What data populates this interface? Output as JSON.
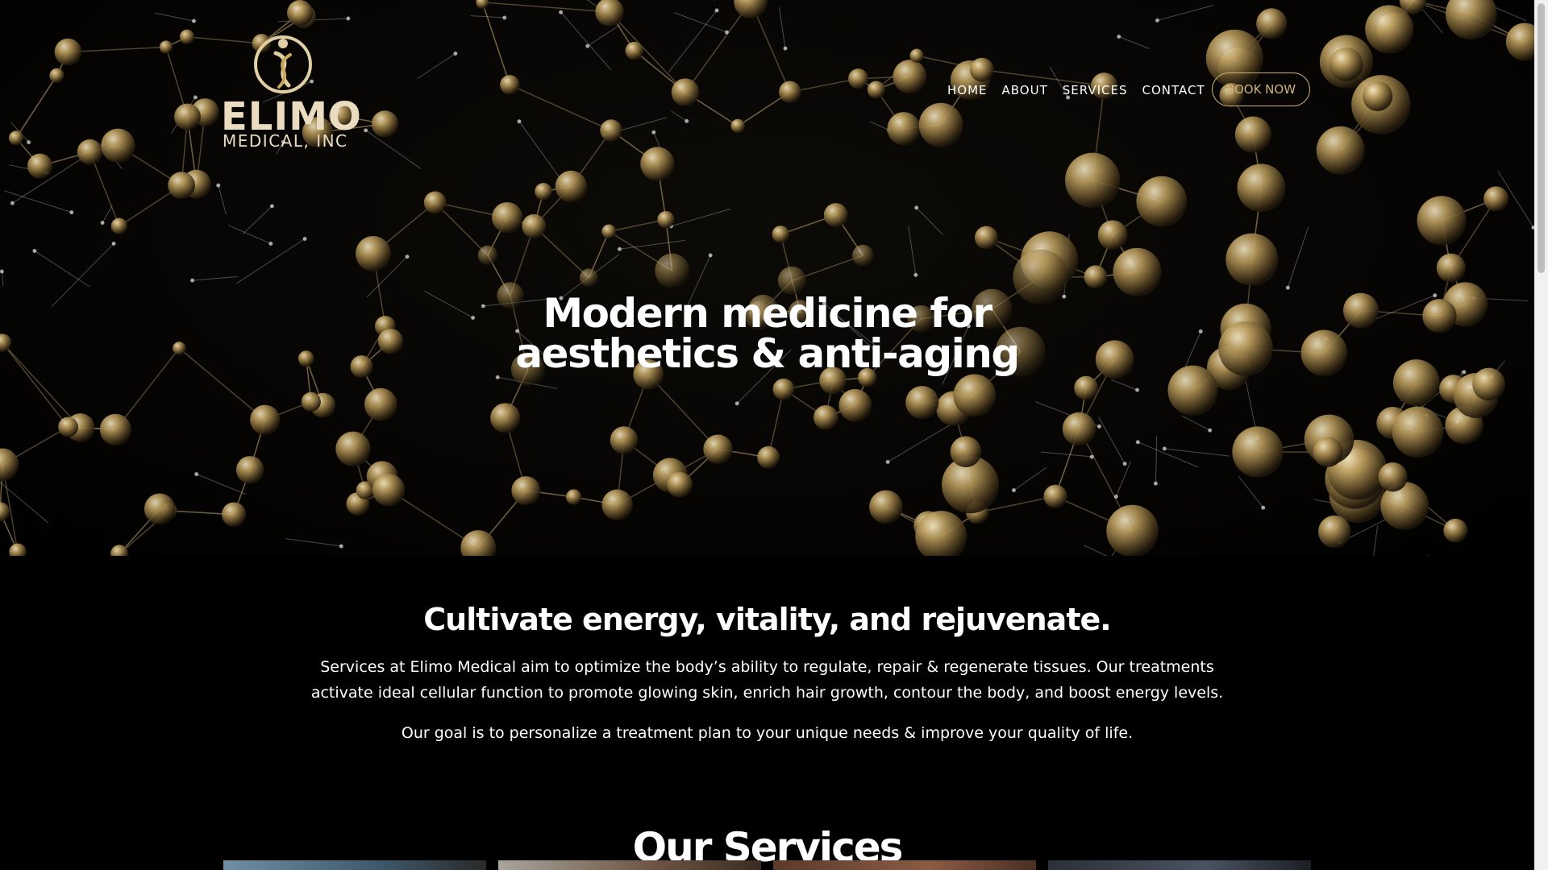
{
  "brand": {
    "name": "ELIMO",
    "sub": "MEDICAL, INC",
    "logo_icon": "figure-swirl-icon",
    "accent": "#cdb27a"
  },
  "nav": {
    "items": [
      {
        "label": "HOME"
      },
      {
        "label": "ABOUT"
      },
      {
        "label": "SERVICES"
      },
      {
        "label": "CONTACT"
      }
    ],
    "book_label": "BOOK NOW"
  },
  "hero": {
    "title_line1": "Modern medicine for",
    "title_line2": "aesthetics & anti-aging"
  },
  "intro": {
    "heading": "Cultivate energy, vitality, and rejuvenate.",
    "paragraph1": "Services at Elimo Medical aim to optimize the body’s ability to regulate, repair & regenerate tissues. Our treatments activate ideal cellular function to promote glowing skin, enrich hair growth, contour the body, and boost energy levels.",
    "paragraph2": "Our goal is to personalize a treatment plan to your unique needs & improve your quality of life."
  },
  "services": {
    "title": "Our Services"
  },
  "colors": {
    "background": "#000000",
    "text": "#ffffff",
    "gold": "#cdb27a"
  }
}
